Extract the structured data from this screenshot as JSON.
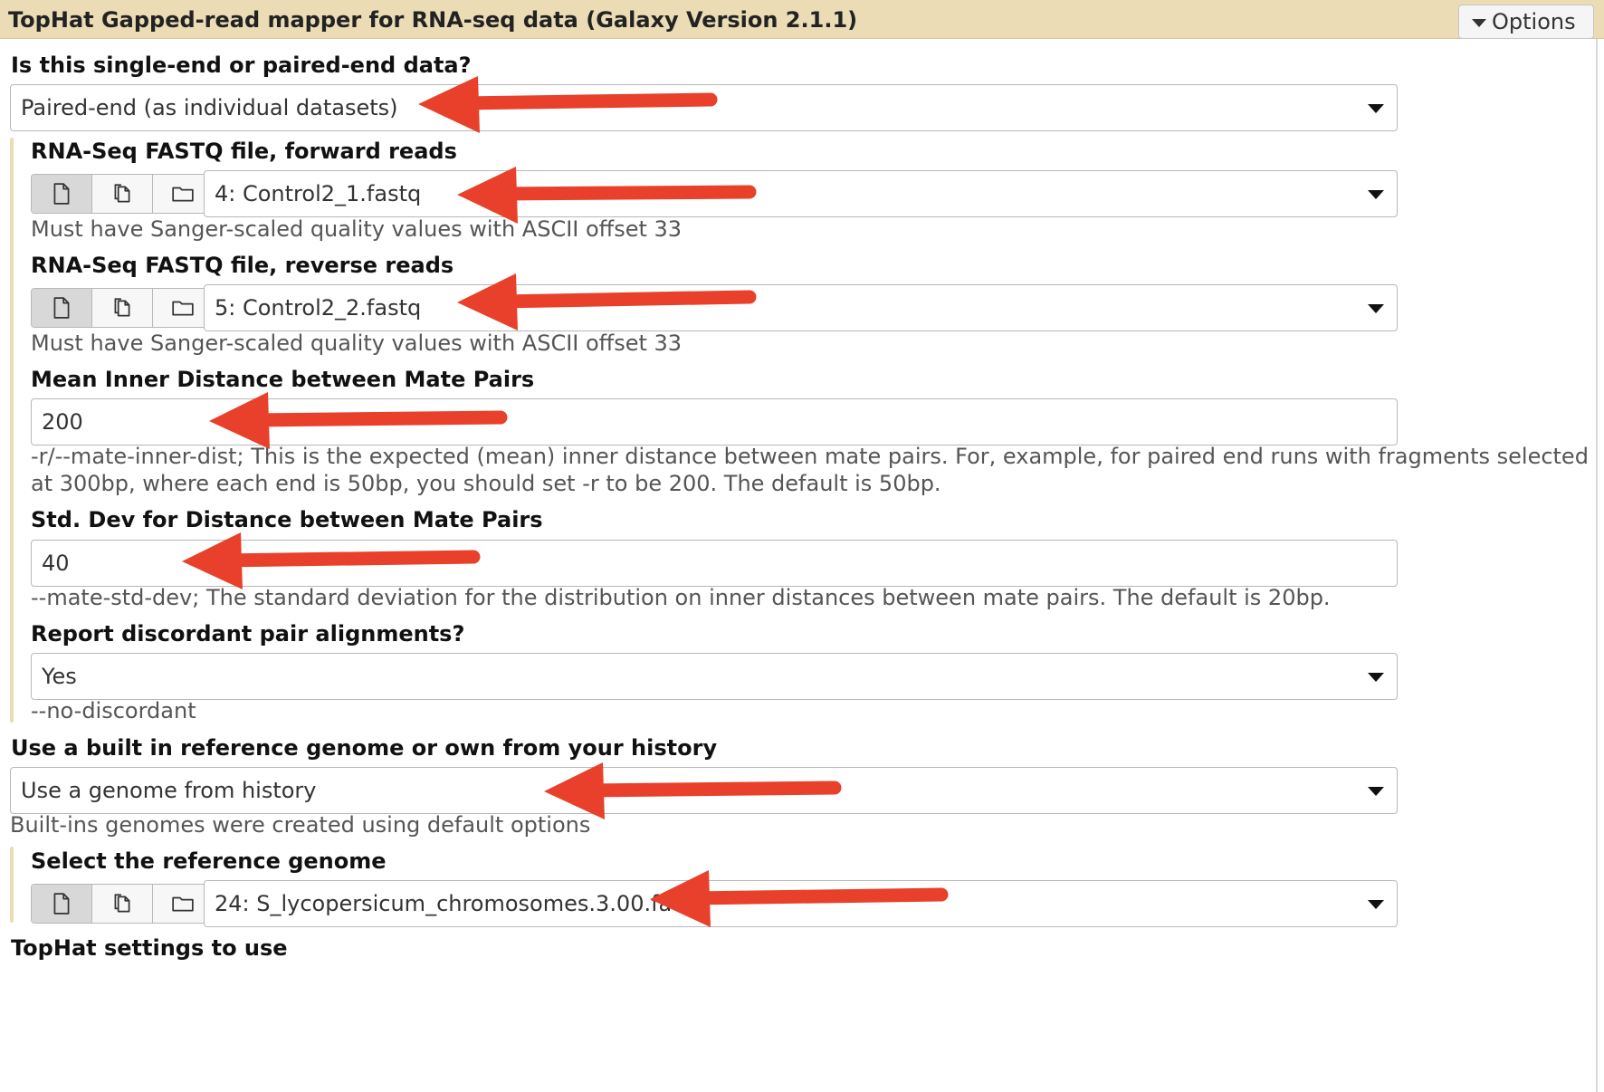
{
  "header": {
    "title": "TopHat Gapped-read mapper for RNA-seq data (Galaxy Version 2.1.1)",
    "options_label": "Options"
  },
  "fields": {
    "pairing": {
      "label": "Is this single-end or paired-end data?",
      "value": "Paired-end (as individual datasets)"
    },
    "forward": {
      "label": "RNA-Seq FASTQ file, forward reads",
      "value": "4: Control2_1.fastq",
      "help": "Must have Sanger-scaled quality values with ASCII offset 33"
    },
    "reverse": {
      "label": "RNA-Seq FASTQ file, reverse reads",
      "value": "5: Control2_2.fastq",
      "help": "Must have Sanger-scaled quality values with ASCII offset 33"
    },
    "mean_inner": {
      "label": "Mean Inner Distance between Mate Pairs",
      "value": "200",
      "help_line1": "-r/--mate-inner-dist; This is the expected (mean) inner distance between mate pairs. For, example, for paired end runs with fragments selected",
      "help_line2": "at 300bp, where each end is 50bp, you should set -r to be 200. The default is 50bp."
    },
    "std_dev": {
      "label": "Std. Dev for Distance between Mate Pairs",
      "value": "40",
      "help": "--mate-std-dev; The standard deviation for the distribution on inner distances between mate pairs. The default is 20bp."
    },
    "discordant": {
      "label": "Report discordant pair alignments?",
      "value": "Yes",
      "help": "--no-discordant"
    },
    "reference_source": {
      "label": "Use a built in reference genome or own from your history",
      "value": "Use a genome from history",
      "help": "Built-ins genomes were created using default options"
    },
    "reference_genome": {
      "label": "Select the reference genome",
      "value": "24: S_lycopersicum_chromosomes.3.00.fa"
    },
    "tophat_settings": {
      "label": "TopHat settings to use"
    }
  },
  "icons": {
    "dataset_buttons": [
      "single-dataset-icon",
      "multiple-datasets-icon",
      "dataset-collection-icon"
    ],
    "annotation_arrow": "red-arrow-icon"
  },
  "colors": {
    "header_bg": "#ebdcb6",
    "section_bar": "#ebdcb6",
    "arrow": "#e8402a",
    "border": "#b8b8b8"
  }
}
